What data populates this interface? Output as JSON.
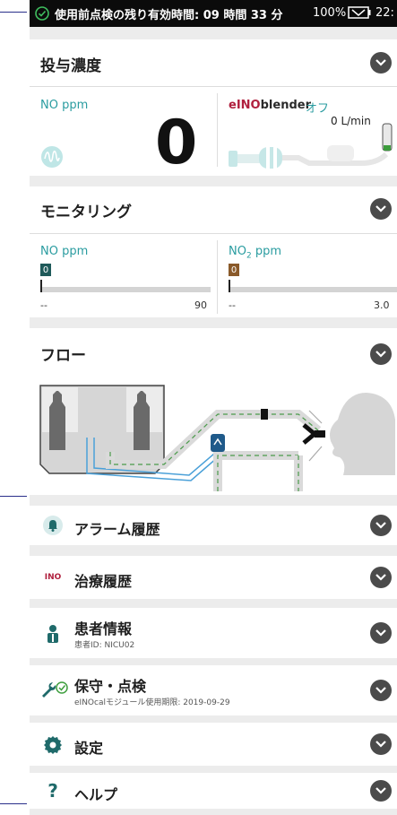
{
  "status_bar": {
    "text": "使用前点検の残り有効時間: 09 時間 33 分",
    "battery_percent": "100%",
    "clock": "22:"
  },
  "dosing": {
    "title": "投与濃度",
    "no_label": "NO ppm",
    "no_value": "0",
    "blender_brand_e": "e",
    "blender_brand_ino": "INO",
    "blender_brand_rest": "blender",
    "blender_state": "オフ",
    "flow_value": "0 L/min"
  },
  "monitoring": {
    "title": "モニタリング",
    "no": {
      "label": "NO ppm",
      "value": "0",
      "min": "--",
      "max": "90"
    },
    "no2": {
      "label_main": "NO",
      "label_sub": "2",
      "label_unit": " ppm",
      "value": "0",
      "min": "--",
      "max": "3.0"
    }
  },
  "flow": {
    "title": "フロー"
  },
  "menu": {
    "alarm_history": "アラーム履歴",
    "therapy_icon_text": "INO",
    "therapy_history": "治療履歴",
    "patient_info": "患者情報",
    "patient_id": "患者ID: NICU02",
    "maintenance": "保守・点検",
    "maintenance_sub": "eINOcalモジュール使用期限: 2019-09-29",
    "settings": "設定",
    "help_icon_text": "?",
    "help": "ヘルプ"
  },
  "colors": {
    "teal": "#2a9ca0",
    "no_box": "#1f5a5a",
    "no2_box": "#8a5a2a",
    "brand_red": "#b0203e"
  }
}
